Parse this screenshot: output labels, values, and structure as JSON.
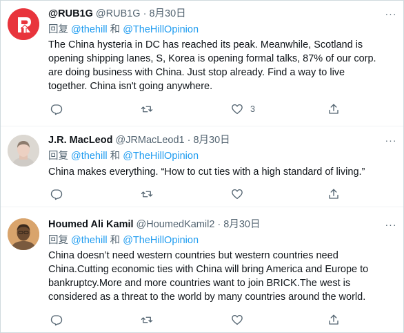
{
  "tweets": [
    {
      "name": "@RUB1G",
      "handle": "@RUB1G",
      "dot": "·",
      "date": "8月30日",
      "reply_prefix": "回复 ",
      "reply_to_1": "@thehill",
      "reply_joiner": " 和 ",
      "reply_to_2": "@TheHillOpinion",
      "body_lines": [
        "The China hysteria in DC has reached its peak. Meanwhile, Scotland is",
        "opening shipping lanes, S, Korea is opening formal talks, 87% of our corp.",
        "are doing business with China. Just stop already. Find a way to live",
        "together. China isn't going anywhere."
      ],
      "like_count": "3",
      "more": "···"
    },
    {
      "name": "J.R. MacLeod",
      "handle": "@JRMacLeod1",
      "dot": "·",
      "date": "8月30日",
      "reply_prefix": "回复 ",
      "reply_to_1": "@thehill",
      "reply_joiner": " 和 ",
      "reply_to_2": "@TheHillOpinion",
      "body_lines": [
        "China makes everything. “How to cut ties with a high standard of living.”"
      ],
      "like_count": "",
      "more": "···"
    },
    {
      "name": "Houmed Ali Kamil",
      "handle": "@HoumedKamil2",
      "dot": "·",
      "date": "8月30日",
      "reply_prefix": "回复 ",
      "reply_to_1": "@thehill",
      "reply_joiner": " 和 ",
      "reply_to_2": "@TheHillOpinion",
      "body_lines": [
        "China doesn’t need western countries but western countries need",
        "China.Cutting economic ties with China will bring America and Europe to",
        "bankruptcy.More and more countries want to join BRICK.The west is",
        "considered as a threat to the world by many countries around the world."
      ],
      "like_count": "",
      "more": "···"
    }
  ],
  "icons": {
    "reply": "reply-icon",
    "retweet": "retweet-icon",
    "like": "heart-icon",
    "share": "share-icon",
    "more": "more-icon"
  },
  "colors": {
    "link": "#1d9bf0",
    "secondary": "#536471",
    "text": "#0f1419",
    "divider": "#eff3f4",
    "rub1g_avatar": "#e8343c"
  }
}
